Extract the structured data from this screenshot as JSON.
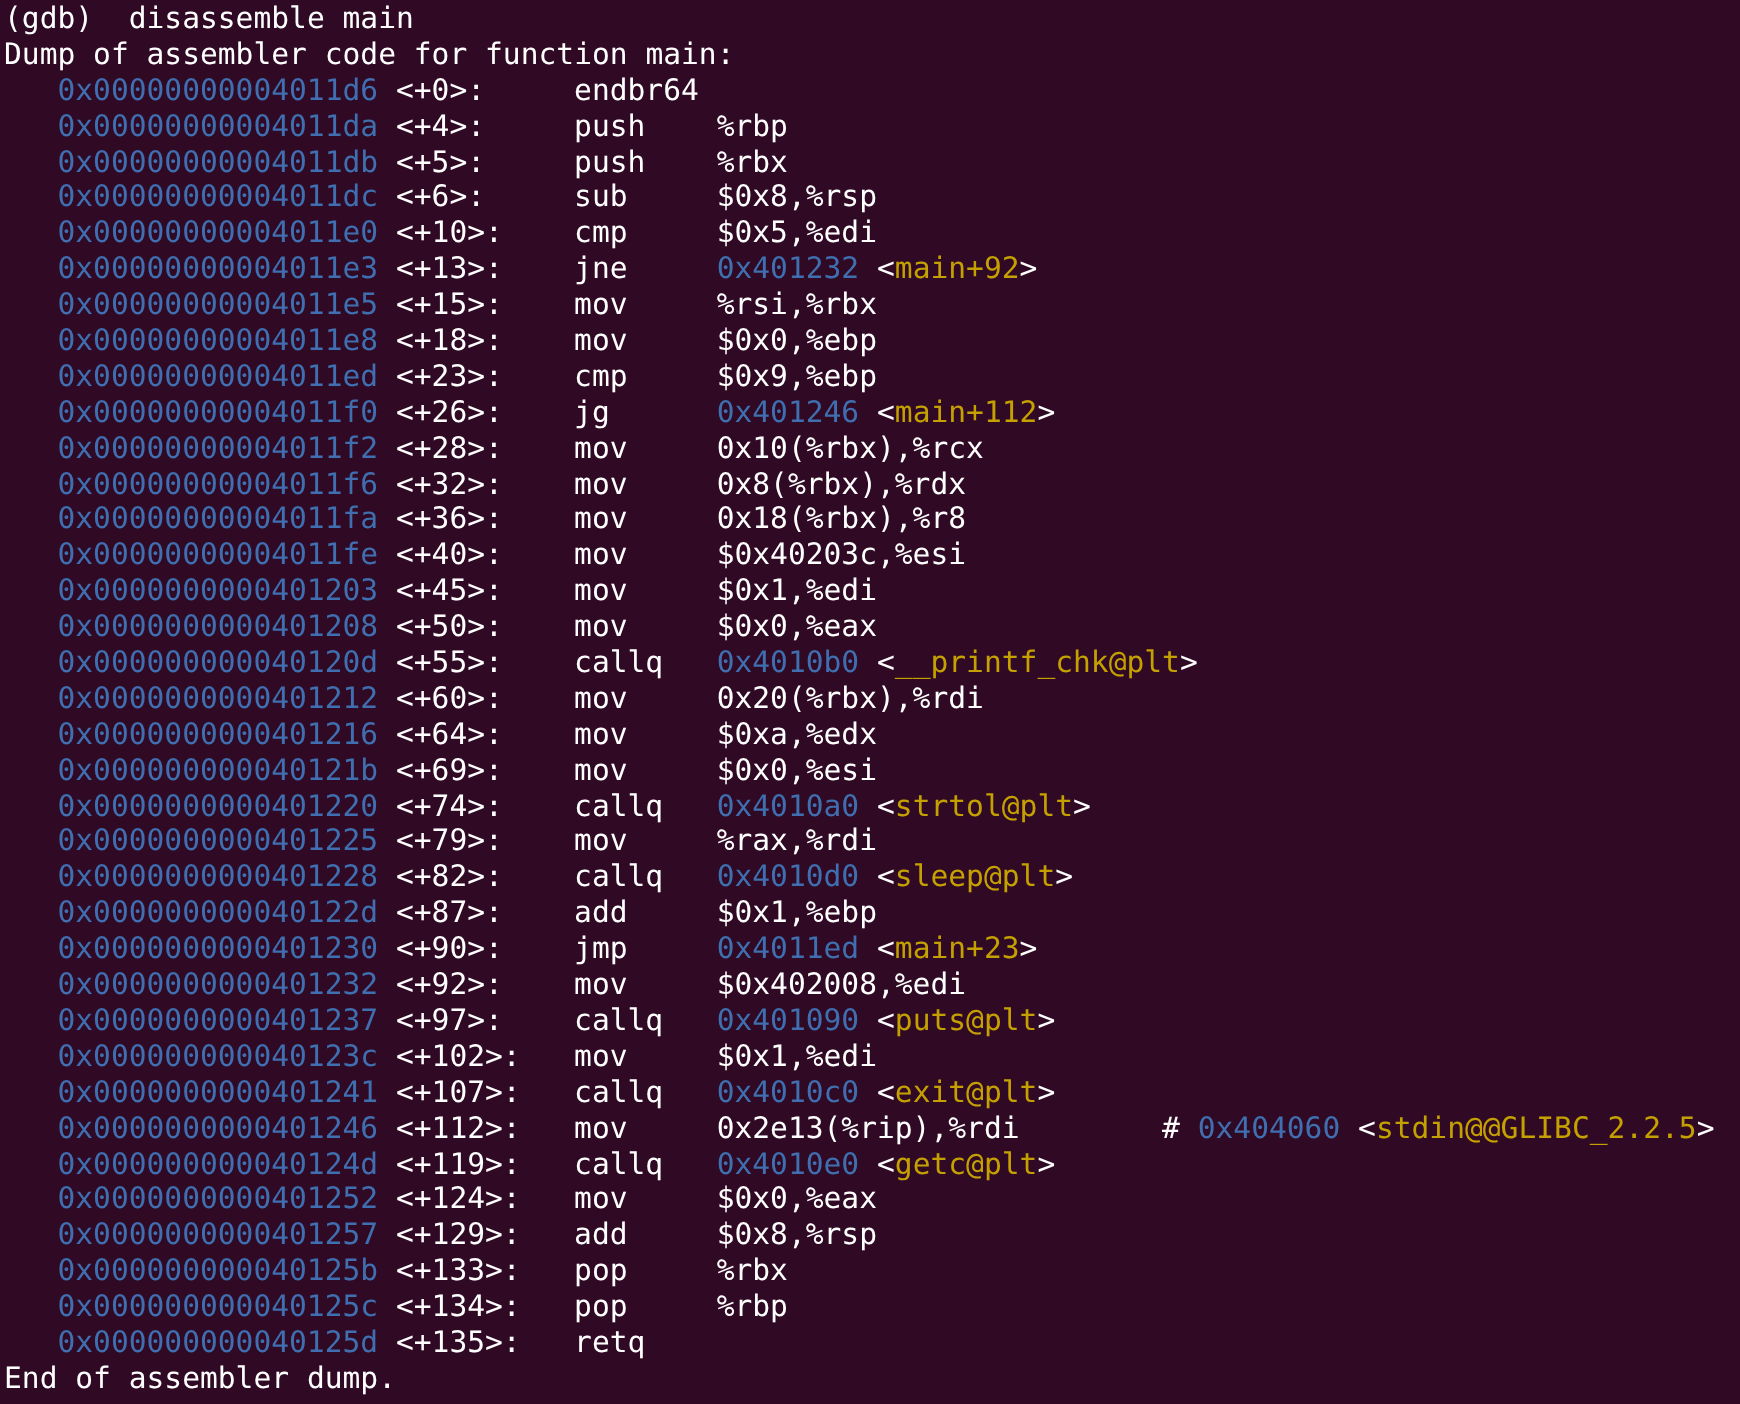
{
  "terminal": {
    "lines": [
      {
        "kind": "prompt",
        "text": "(gdb)  disassemble main"
      },
      {
        "kind": "text",
        "text": "Dump of assembler code for function main:"
      },
      {
        "kind": "insn",
        "address": "0x00000000004011d6",
        "offset": "<+0>:",
        "mnemonic": "endbr64"
      },
      {
        "kind": "insn",
        "address": "0x00000000004011da",
        "offset": "<+4>:",
        "mnemonic": "push",
        "operands": [
          {
            "kind": "plain",
            "text": "%rbp"
          }
        ]
      },
      {
        "kind": "insn",
        "address": "0x00000000004011db",
        "offset": "<+5>:",
        "mnemonic": "push",
        "operands": [
          {
            "kind": "plain",
            "text": "%rbx"
          }
        ]
      },
      {
        "kind": "insn",
        "address": "0x00000000004011dc",
        "offset": "<+6>:",
        "mnemonic": "sub",
        "operands": [
          {
            "kind": "plain",
            "text": "$0x8,%rsp"
          }
        ]
      },
      {
        "kind": "insn",
        "address": "0x00000000004011e0",
        "offset": "<+10>:",
        "mnemonic": "cmp",
        "operands": [
          {
            "kind": "plain",
            "text": "$0x5,%edi"
          }
        ]
      },
      {
        "kind": "insn",
        "address": "0x00000000004011e3",
        "offset": "<+13>:",
        "mnemonic": "jne",
        "operands": [
          {
            "kind": "address",
            "text": "0x401232"
          },
          {
            "kind": "plain",
            "text": " <"
          },
          {
            "kind": "symbol",
            "text": "main+92"
          },
          {
            "kind": "plain",
            "text": ">"
          }
        ]
      },
      {
        "kind": "insn",
        "address": "0x00000000004011e5",
        "offset": "<+15>:",
        "mnemonic": "mov",
        "operands": [
          {
            "kind": "plain",
            "text": "%rsi,%rbx"
          }
        ]
      },
      {
        "kind": "insn",
        "address": "0x00000000004011e8",
        "offset": "<+18>:",
        "mnemonic": "mov",
        "operands": [
          {
            "kind": "plain",
            "text": "$0x0,%ebp"
          }
        ]
      },
      {
        "kind": "insn",
        "address": "0x00000000004011ed",
        "offset": "<+23>:",
        "mnemonic": "cmp",
        "operands": [
          {
            "kind": "plain",
            "text": "$0x9,%ebp"
          }
        ]
      },
      {
        "kind": "insn",
        "address": "0x00000000004011f0",
        "offset": "<+26>:",
        "mnemonic": "jg",
        "operands": [
          {
            "kind": "address",
            "text": "0x401246"
          },
          {
            "kind": "plain",
            "text": " <"
          },
          {
            "kind": "symbol",
            "text": "main+112"
          },
          {
            "kind": "plain",
            "text": ">"
          }
        ]
      },
      {
        "kind": "insn",
        "address": "0x00000000004011f2",
        "offset": "<+28>:",
        "mnemonic": "mov",
        "operands": [
          {
            "kind": "plain",
            "text": "0x10(%rbx),%rcx"
          }
        ]
      },
      {
        "kind": "insn",
        "address": "0x00000000004011f6",
        "offset": "<+32>:",
        "mnemonic": "mov",
        "operands": [
          {
            "kind": "plain",
            "text": "0x8(%rbx),%rdx"
          }
        ]
      },
      {
        "kind": "insn",
        "address": "0x00000000004011fa",
        "offset": "<+36>:",
        "mnemonic": "mov",
        "operands": [
          {
            "kind": "plain",
            "text": "0x18(%rbx),%r8"
          }
        ]
      },
      {
        "kind": "insn",
        "address": "0x00000000004011fe",
        "offset": "<+40>:",
        "mnemonic": "mov",
        "operands": [
          {
            "kind": "plain",
            "text": "$0x40203c,%esi"
          }
        ]
      },
      {
        "kind": "insn",
        "address": "0x0000000000401203",
        "offset": "<+45>:",
        "mnemonic": "mov",
        "operands": [
          {
            "kind": "plain",
            "text": "$0x1,%edi"
          }
        ]
      },
      {
        "kind": "insn",
        "address": "0x0000000000401208",
        "offset": "<+50>:",
        "mnemonic": "mov",
        "operands": [
          {
            "kind": "plain",
            "text": "$0x0,%eax"
          }
        ]
      },
      {
        "kind": "insn",
        "address": "0x000000000040120d",
        "offset": "<+55>:",
        "mnemonic": "callq",
        "operands": [
          {
            "kind": "address",
            "text": "0x4010b0"
          },
          {
            "kind": "plain",
            "text": " <"
          },
          {
            "kind": "symbol",
            "text": "__printf_chk@plt"
          },
          {
            "kind": "plain",
            "text": ">"
          }
        ]
      },
      {
        "kind": "insn",
        "address": "0x0000000000401212",
        "offset": "<+60>:",
        "mnemonic": "mov",
        "operands": [
          {
            "kind": "plain",
            "text": "0x20(%rbx),%rdi"
          }
        ]
      },
      {
        "kind": "insn",
        "address": "0x0000000000401216",
        "offset": "<+64>:",
        "mnemonic": "mov",
        "operands": [
          {
            "kind": "plain",
            "text": "$0xa,%edx"
          }
        ]
      },
      {
        "kind": "insn",
        "address": "0x000000000040121b",
        "offset": "<+69>:",
        "mnemonic": "mov",
        "operands": [
          {
            "kind": "plain",
            "text": "$0x0,%esi"
          }
        ]
      },
      {
        "kind": "insn",
        "address": "0x0000000000401220",
        "offset": "<+74>:",
        "mnemonic": "callq",
        "operands": [
          {
            "kind": "address",
            "text": "0x4010a0"
          },
          {
            "kind": "plain",
            "text": " <"
          },
          {
            "kind": "symbol",
            "text": "strtol@plt"
          },
          {
            "kind": "plain",
            "text": ">"
          }
        ]
      },
      {
        "kind": "insn",
        "address": "0x0000000000401225",
        "offset": "<+79>:",
        "mnemonic": "mov",
        "operands": [
          {
            "kind": "plain",
            "text": "%rax,%rdi"
          }
        ]
      },
      {
        "kind": "insn",
        "address": "0x0000000000401228",
        "offset": "<+82>:",
        "mnemonic": "callq",
        "operands": [
          {
            "kind": "address",
            "text": "0x4010d0"
          },
          {
            "kind": "plain",
            "text": " <"
          },
          {
            "kind": "symbol",
            "text": "sleep@plt"
          },
          {
            "kind": "plain",
            "text": ">"
          }
        ]
      },
      {
        "kind": "insn",
        "address": "0x000000000040122d",
        "offset": "<+87>:",
        "mnemonic": "add",
        "operands": [
          {
            "kind": "plain",
            "text": "$0x1,%ebp"
          }
        ]
      },
      {
        "kind": "insn",
        "address": "0x0000000000401230",
        "offset": "<+90>:",
        "mnemonic": "jmp",
        "operands": [
          {
            "kind": "address",
            "text": "0x4011ed"
          },
          {
            "kind": "plain",
            "text": " <"
          },
          {
            "kind": "symbol",
            "text": "main+23"
          },
          {
            "kind": "plain",
            "text": ">"
          }
        ]
      },
      {
        "kind": "insn",
        "address": "0x0000000000401232",
        "offset": "<+92>:",
        "mnemonic": "mov",
        "operands": [
          {
            "kind": "plain",
            "text": "$0x402008,%edi"
          }
        ]
      },
      {
        "kind": "insn",
        "address": "0x0000000000401237",
        "offset": "<+97>:",
        "mnemonic": "callq",
        "operands": [
          {
            "kind": "address",
            "text": "0x401090"
          },
          {
            "kind": "plain",
            "text": " <"
          },
          {
            "kind": "symbol",
            "text": "puts@plt"
          },
          {
            "kind": "plain",
            "text": ">"
          }
        ]
      },
      {
        "kind": "insn",
        "address": "0x000000000040123c",
        "offset": "<+102>:",
        "mnemonic": "mov",
        "operands": [
          {
            "kind": "plain",
            "text": "$0x1,%edi"
          }
        ]
      },
      {
        "kind": "insn",
        "address": "0x0000000000401241",
        "offset": "<+107>:",
        "mnemonic": "callq",
        "operands": [
          {
            "kind": "address",
            "text": "0x4010c0"
          },
          {
            "kind": "plain",
            "text": " <"
          },
          {
            "kind": "symbol",
            "text": "exit@plt"
          },
          {
            "kind": "plain",
            "text": ">"
          }
        ]
      },
      {
        "kind": "insn",
        "address": "0x0000000000401246",
        "offset": "<+112>:",
        "mnemonic": "mov",
        "operands": [
          {
            "kind": "plain",
            "text": "0x2e13(%rip),%rdi"
          }
        ],
        "comment": [
          {
            "kind": "plain",
            "text": "# "
          },
          {
            "kind": "address",
            "text": "0x404060"
          },
          {
            "kind": "plain",
            "text": " <"
          },
          {
            "kind": "symbol",
            "text": "stdin@@GLIBC_2.2.5"
          },
          {
            "kind": "plain",
            "text": ">"
          }
        ]
      },
      {
        "kind": "insn",
        "address": "0x000000000040124d",
        "offset": "<+119>:",
        "mnemonic": "callq",
        "operands": [
          {
            "kind": "address",
            "text": "0x4010e0"
          },
          {
            "kind": "plain",
            "text": " <"
          },
          {
            "kind": "symbol",
            "text": "getc@plt"
          },
          {
            "kind": "plain",
            "text": ">"
          }
        ]
      },
      {
        "kind": "insn",
        "address": "0x0000000000401252",
        "offset": "<+124>:",
        "mnemonic": "mov",
        "operands": [
          {
            "kind": "plain",
            "text": "$0x0,%eax"
          }
        ]
      },
      {
        "kind": "insn",
        "address": "0x0000000000401257",
        "offset": "<+129>:",
        "mnemonic": "add",
        "operands": [
          {
            "kind": "plain",
            "text": "$0x8,%rsp"
          }
        ]
      },
      {
        "kind": "insn",
        "address": "0x000000000040125b",
        "offset": "<+133>:",
        "mnemonic": "pop",
        "operands": [
          {
            "kind": "plain",
            "text": "%rbx"
          }
        ]
      },
      {
        "kind": "insn",
        "address": "0x000000000040125c",
        "offset": "<+134>:",
        "mnemonic": "pop",
        "operands": [
          {
            "kind": "plain",
            "text": "%rbp"
          }
        ]
      },
      {
        "kind": "insn",
        "address": "0x000000000040125d",
        "offset": "<+135>:",
        "mnemonic": "retq"
      },
      {
        "kind": "text",
        "text": "End of assembler dump."
      }
    ]
  }
}
